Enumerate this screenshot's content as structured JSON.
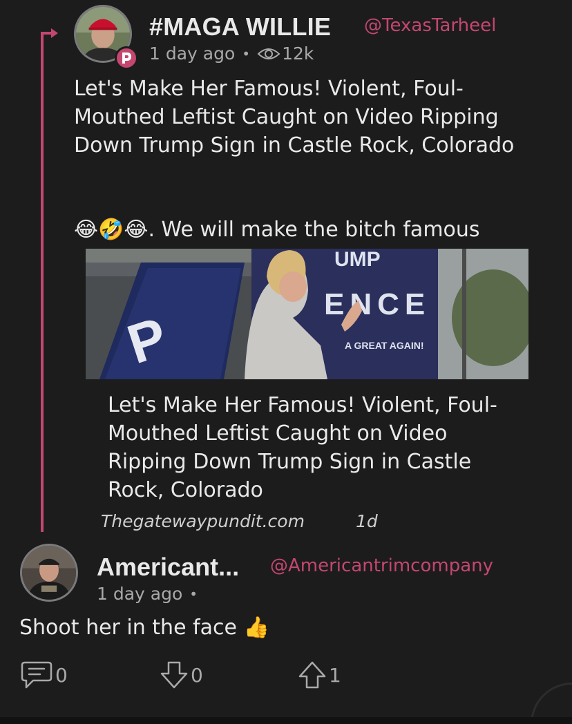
{
  "parent_post": {
    "author_name": "#MAGA WILLIE",
    "handle": "@TexasTarheel",
    "time": "1 day ago",
    "views": "12k",
    "text": "Let's Make Her Famous! Violent, Foul-Mouthed Leftist Caught on Video Ripping Down Trump Sign in Castle Rock, Colorado",
    "text2": "😂🤣😂. We will make the bitch famous",
    "link_title": "Let's Make Her Famous! Violent, Foul-Mouthed Leftist Caught on Video Ripping Down Trump Sign in Castle Rock, Colorado",
    "link_source": "Thegatewaypundit.com",
    "link_time": "1d",
    "image_sign_text": [
      "UMP",
      "ENCE",
      "A GREAT AGAIN!"
    ]
  },
  "reply": {
    "author_name": "Americant...",
    "handle": "@Americantrimcompany",
    "time": "1 day ago",
    "text": "Shoot her in the face 👍"
  },
  "actions": {
    "comments": "0",
    "downvotes": "0",
    "upvotes": "1"
  },
  "colors": {
    "accent": "#c4476f",
    "background": "#1c1c1d",
    "muted": "#a9a9ab"
  },
  "icons": [
    "parler-logo-icon",
    "eye-icon",
    "comment-icon",
    "downvote-icon",
    "upvote-icon"
  ]
}
